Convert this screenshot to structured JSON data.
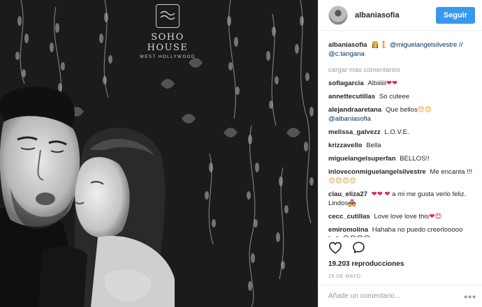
{
  "media": {
    "logo_name": "SOHO HOUSE",
    "logo_sub": "WEST HOLLYWOOD"
  },
  "header": {
    "username": "albaniasofia",
    "follow_label": "Seguir",
    "accent": "#3897f0"
  },
  "caption": {
    "username": "albaniasofia",
    "emoji": "👸🧜",
    "mention1": "@miguelangelsilvestre",
    "sep": " //",
    "mention2": "@c.tangana"
  },
  "load_more": "cargar más comentarios",
  "comments": [
    {
      "user": "sofiagarcia",
      "text": "Albiiiiii",
      "tail": "❤❤"
    },
    {
      "user": "annettecutillas",
      "text": "So cuteee",
      "tail": ""
    },
    {
      "user": "alejandraaretana",
      "text": "Que bellos",
      "tail": "😍😍",
      "mention": "@albaniasofia"
    },
    {
      "user": "melissa_galvezz",
      "text": "L.O.V.E.",
      "tail": ""
    },
    {
      "user": "krizzavello",
      "text": "Bella",
      "tail": ""
    },
    {
      "user": "miguelangelsuperfan",
      "text": "BELLOS!!",
      "tail": ""
    },
    {
      "user": "inloveconmiguelangelsilvestre",
      "text": "Me encanta !!!",
      "tail": "😍😍😍😍"
    },
    {
      "user": "clau_eliza27",
      "text": "",
      "tail": "❤❤ ❤",
      "text2": " a mi me gusta verlo feliz. Lindos",
      "tail2": "💑"
    },
    {
      "user": "cecc_cutillas",
      "text": "Love love love this",
      "tail": "❤😍"
    },
    {
      "user": "emiromolina",
      "text": "Hahaha no puedo creerlooooo bella",
      "tail": "😆😆😆😆"
    }
  ],
  "actions": {
    "like_icon": "heart-icon",
    "comment_icon": "comment-icon"
  },
  "views": {
    "count": "19.203",
    "label": "reproducciones"
  },
  "date": "29 DE MAYO",
  "add_comment": {
    "placeholder": "Añade un comentario...",
    "more": "•••"
  }
}
